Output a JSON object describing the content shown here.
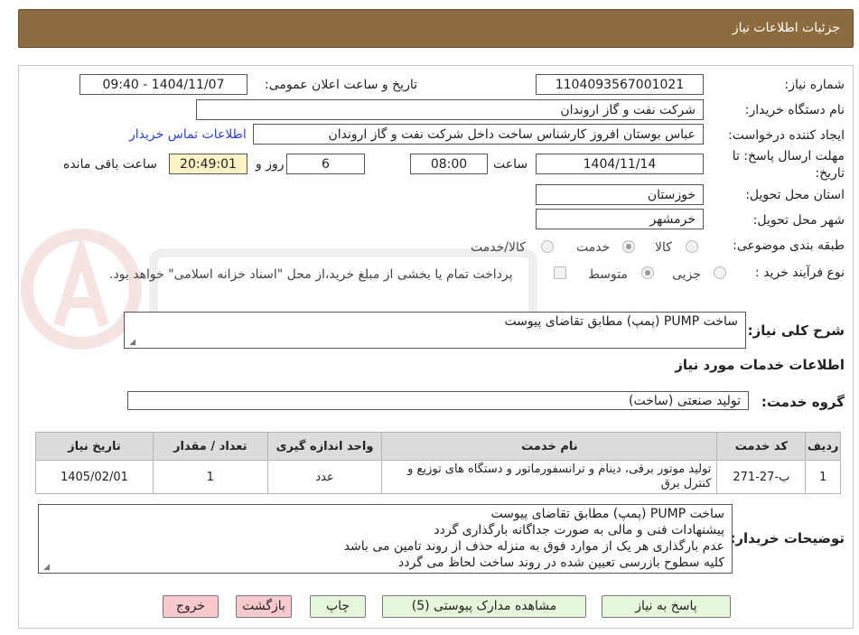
{
  "header": {
    "title": "جزئیات اطلاعات نیاز"
  },
  "form": {
    "need_number": {
      "label": "شماره نیاز:",
      "value": "1104093567001021"
    },
    "announce_datetime": {
      "label": "تاریخ و ساعت اعلان عمومی:",
      "value": "1404/11/07 - 09:40"
    },
    "buyer_org": {
      "label": "نام دستگاه خریدار:",
      "value": "شرکت نفت و گاز اروندان"
    },
    "requester": {
      "label": "ایجاد کننده درخواست:",
      "value": "عباس بوستان افروز کارشناس ساخت داخل شرکت نفت و گاز اروندان"
    },
    "buyer_contact_link": "اطلاعات تماس خریدار",
    "deadline": {
      "label_line1": "مهلت ارسال پاسخ: تا",
      "label_line2": "تاریخ:",
      "date": "1404/11/14",
      "time_label": "ساعت",
      "time": "08:00",
      "days": "6",
      "days_label": "روز و",
      "remaining": "20:49:01",
      "remaining_label": "ساعت باقی مانده"
    },
    "province": {
      "label": "استان محل تحویل:",
      "value": "خوزستان"
    },
    "city": {
      "label": "شهر محل تحویل:",
      "value": "خرمشهر"
    },
    "category": {
      "label": "طبقه بندی موضوعی:",
      "options": [
        "کالا",
        "خدمت",
        "کالا/خدمت"
      ],
      "selected": "خدمت"
    },
    "process": {
      "label": "نوع فرآیند خرید :",
      "options": [
        "جزیی",
        "متوسط"
      ],
      "selected": "متوسط",
      "payment_note": "پرداخت تمام یا بخشی از مبلغ خرید،از محل \"اسناد خزانه اسلامی\" خواهد بود."
    }
  },
  "summary": {
    "label": "شرح کلی نیاز:",
    "value": "ساخت PUMP  (پمپ)  مطابق تقاضای پیوست"
  },
  "services_title": "اطلاعات خدمات مورد نیاز",
  "service_group": {
    "label": "گروه خدمت:",
    "value": "تولید صنعتی (ساخت)"
  },
  "table": {
    "headers": [
      "ردیف",
      "کد خدمت",
      "نام خدمت",
      "واحد اندازه گیری",
      "تعداد / مقدار",
      "تاریخ نیاز"
    ],
    "rows": [
      [
        "1",
        "ب-27-271",
        "تولید موتور برقی، دینام و ترانسفورماتور و دستگاه های توزیع و کنترل برق",
        "عدد",
        "1",
        "1405/02/01"
      ]
    ]
  },
  "buyer_notes": {
    "label": "توضیحات خریدار:",
    "lines": [
      "ساخت PUMP  (پمپ)  مطابق تقاضای پیوست",
      "پیشنهادات فنی و مالی به صورت جداگانه بارگذاری گردد",
      "عدم بارگذاری هر یک از موارد فوق به منزله حذف از روند تامین می باشد",
      "کلیه سطوح بازرسی تعیین شده در روند ساخت لحاظ می گردد"
    ]
  },
  "buttons": {
    "reply": "پاسخ به نیاز",
    "attachments": "مشاهده مدارک پیوستی (5)",
    "print": "چاپ",
    "back": "بازگشت",
    "exit": "خروج"
  },
  "colors": {
    "header_bg": "#8c6b3e",
    "link": "#2a3fd8",
    "time_bg": "#fdf3c4",
    "btn_green": "#e6f6da",
    "btn_pink": "#f8c9cd"
  }
}
